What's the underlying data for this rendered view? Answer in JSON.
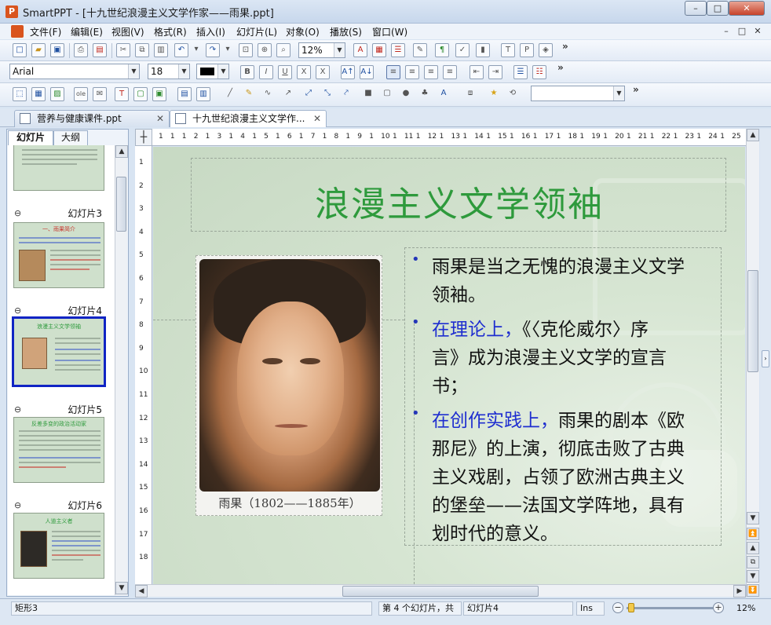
{
  "window": {
    "title": "SmartPPT - [十九世纪浪漫主义文学作家——雨果.ppt]",
    "app_icon": "P",
    "buttons": [
      "–",
      "□",
      "✕"
    ]
  },
  "menu": {
    "items": [
      "文件(F)",
      "编辑(E)",
      "视图(V)",
      "格式(R)",
      "插入(I)",
      "幻灯片(L)",
      "对象(O)",
      "播放(S)",
      "窗口(W)"
    ],
    "mdi_buttons": [
      "–",
      "□",
      "✕"
    ]
  },
  "toolbar1": {
    "zoom_value": "12%",
    "more": "»"
  },
  "toolbar2": {
    "font_name": "Arial",
    "font_size": "18",
    "bold": "B",
    "italic": "I",
    "underline": "U",
    "more": "»"
  },
  "toolbar3": {
    "shape_combo": "",
    "more": "»"
  },
  "tabs": [
    {
      "label": "营养与健康课件.ppt",
      "close": "✕"
    },
    {
      "label": "十九世纪浪漫主义文学作...",
      "close": "✕"
    }
  ],
  "left_panel": {
    "tabs": [
      "幻灯片",
      "大纲"
    ],
    "slides": [
      {
        "label": "幻灯片3",
        "mark": "⊖",
        "title": "一、雨果简介"
      },
      {
        "label": "幻灯片4",
        "mark": "⊖",
        "title": "浪漫主义文学领袖"
      },
      {
        "label": "幻灯片5",
        "mark": "⊖",
        "title": "反差多变的政治活动家"
      },
      {
        "label": "幻灯片6",
        "mark": "⊖",
        "title": "人道主义者"
      }
    ]
  },
  "ruler": {
    "h_ticks": [
      "1",
      "1",
      "1",
      "2",
      "1",
      "3",
      "1",
      "4",
      "1",
      "5",
      "1",
      "6",
      "1",
      "7",
      "1",
      "8",
      "1",
      "9",
      "1",
      "10",
      "1",
      "11",
      "1",
      "12",
      "1",
      "13",
      "1",
      "14",
      "1",
      "15",
      "1",
      "16",
      "1",
      "17",
      "1",
      "18",
      "1",
      "19",
      "1",
      "20",
      "1",
      "21",
      "1",
      "22",
      "1",
      "23",
      "1",
      "24",
      "1",
      "25"
    ],
    "v_ticks": [
      "1",
      "2",
      "3",
      "4",
      "5",
      "6",
      "7",
      "8",
      "9",
      "10",
      "11",
      "12",
      "13",
      "14",
      "15",
      "16",
      "17",
      "18"
    ],
    "corner": "┼"
  },
  "slide": {
    "title": "浪漫主义文学领袖",
    "portrait_caption": "雨果（1802——1885年）",
    "bullets": [
      {
        "lines": [
          {
            "plain": "雨果是当之无愧的浪漫主义文学"
          },
          {
            "plain": "领袖。"
          }
        ]
      },
      {
        "lines": [
          {
            "hl": "在理论上，",
            "plain": "《〈克伦威尔〉序"
          },
          {
            "plain": "言》成为浪漫主义文学的宣言"
          },
          {
            "plain": "书；"
          }
        ]
      },
      {
        "lines": [
          {
            "hl": "在创作实践上，",
            "plain": "雨果的剧本《欧"
          },
          {
            "plain": "那尼》的上演，彻底击败了古典"
          },
          {
            "plain": "主义戏剧，占领了欧洲古典主义"
          },
          {
            "plain": "的堡垒——法国文学阵地，具有"
          },
          {
            "plain": "划时代的意义。"
          }
        ]
      }
    ]
  },
  "status": {
    "shape": "矩形3",
    "position": "第 4 个幻灯片，共",
    "slide_name": "幻灯片4",
    "mode": "Ins",
    "zoom": "12%",
    "zoom_minus": "−",
    "zoom_plus": "+"
  },
  "colors": {
    "title_green": "#2e9a3c",
    "highlight_blue": "#1f2ed0",
    "selection_border": "#1024c4"
  }
}
